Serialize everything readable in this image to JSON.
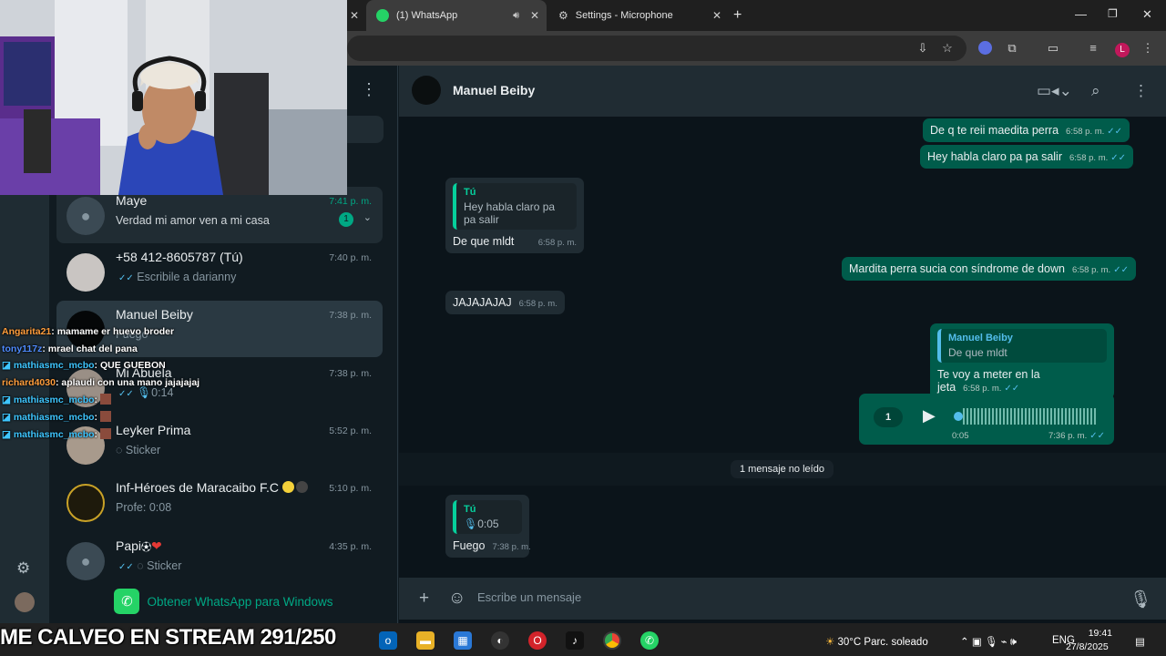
{
  "colors": {
    "accent": "#00a884",
    "outgoing_bubble": "#005c4b",
    "incoming_bubble": "#202c33",
    "read_ticks": "#53bdeb"
  },
  "browser": {
    "tabs": [
      {
        "title": "(1) WhatsApp",
        "icon": "whatsapp-icon",
        "active": true
      },
      {
        "title": "Settings - Microphone",
        "icon": "gear-icon",
        "active": false
      }
    ],
    "new_tab_label": "+",
    "profile_initial": "L"
  },
  "chat_list": [
    {
      "name": "Maye",
      "preview": "Verdad mi amor ven a mi casa",
      "time": "7:41 p. m.",
      "unread": "1"
    },
    {
      "name": "+58 412-8605787 (Tú)",
      "preview": "Escribile a darianny",
      "time": "7:40 p. m."
    },
    {
      "name": "Manuel Beiby",
      "preview": "Fuego",
      "time": "7:38 p. m."
    },
    {
      "name": "Mi Abuela",
      "preview": "0:14",
      "time": "7:38 p. m."
    },
    {
      "name": "Leyker Prima",
      "preview": "Sticker",
      "time": "5:52 p. m."
    },
    {
      "name": "Inf-Héroes de Maracaibo F.C",
      "preview": "Profe: 0:08",
      "time": "5:10 p. m."
    },
    {
      "name": "Papi",
      "preview": "Sticker",
      "time": "4:35 p. m."
    }
  ],
  "get_whatsapp": "Obtener WhatsApp para Windows",
  "conversation": {
    "contact": "Manuel Beiby",
    "messages": [
      {
        "text": "De q te reii maedita perra",
        "time": "6:58 p. m."
      },
      {
        "text": "Hey habla claro pa pa salir",
        "time": "6:58 p. m."
      },
      {
        "quote_name": "Tú",
        "quote_text": "Hey habla claro pa pa salir",
        "text": "De que mldt",
        "time": "6:58 p. m."
      },
      {
        "text": "Mardita perra sucia con síndrome de down",
        "time": "6:58 p. m."
      },
      {
        "text": "JAJAJAJAJ",
        "time": "6:58 p. m."
      },
      {
        "quote_name": "Manuel Beiby",
        "quote_text": "De que mldt",
        "text": "Te voy a meter en la jeta",
        "time": "6:58 p. m."
      },
      {
        "voice_speed": "1",
        "voice_duration": "0:05",
        "time": "7:36 p. m."
      },
      {
        "quote_name": "Tú",
        "quote_text": "0:05",
        "text": "Fuego",
        "time": "7:38 p. m."
      }
    ],
    "unread_separator": "1 mensaje no leído",
    "composer_placeholder": "Escribe un mensaje"
  },
  "stream_chat": [
    {
      "user": "Angarita21",
      "msg": ": mamame er huevo broder",
      "color": "#ff9d3c"
    },
    {
      "user": "tony117z",
      "msg": ": mrael chat del pana",
      "color": "#4f8cff"
    },
    {
      "user": "mathiasmc_mcbo",
      "msg": ": QUE GUEBON",
      "color": "#3ec6ff"
    },
    {
      "user": "richard4030",
      "msg": ": aplaudi con una mano jajajajaj",
      "color": "#ff9d3c"
    },
    {
      "user": "mathiasmc_mcbo",
      "msg": ":",
      "color": "#3ec6ff"
    },
    {
      "user": "mathiasmc_mcbo",
      "msg": ":",
      "color": "#3ec6ff"
    },
    {
      "user": "mathiasmc_mcbo",
      "msg": ":",
      "color": "#3ec6ff"
    }
  ],
  "stream_banner": "ME CALVEO EN STREAM 291/250",
  "taskbar": {
    "weather": "30°C  Parc. soleado",
    "lang": "ENG",
    "time": "19:41",
    "date": "27/8/2025"
  }
}
